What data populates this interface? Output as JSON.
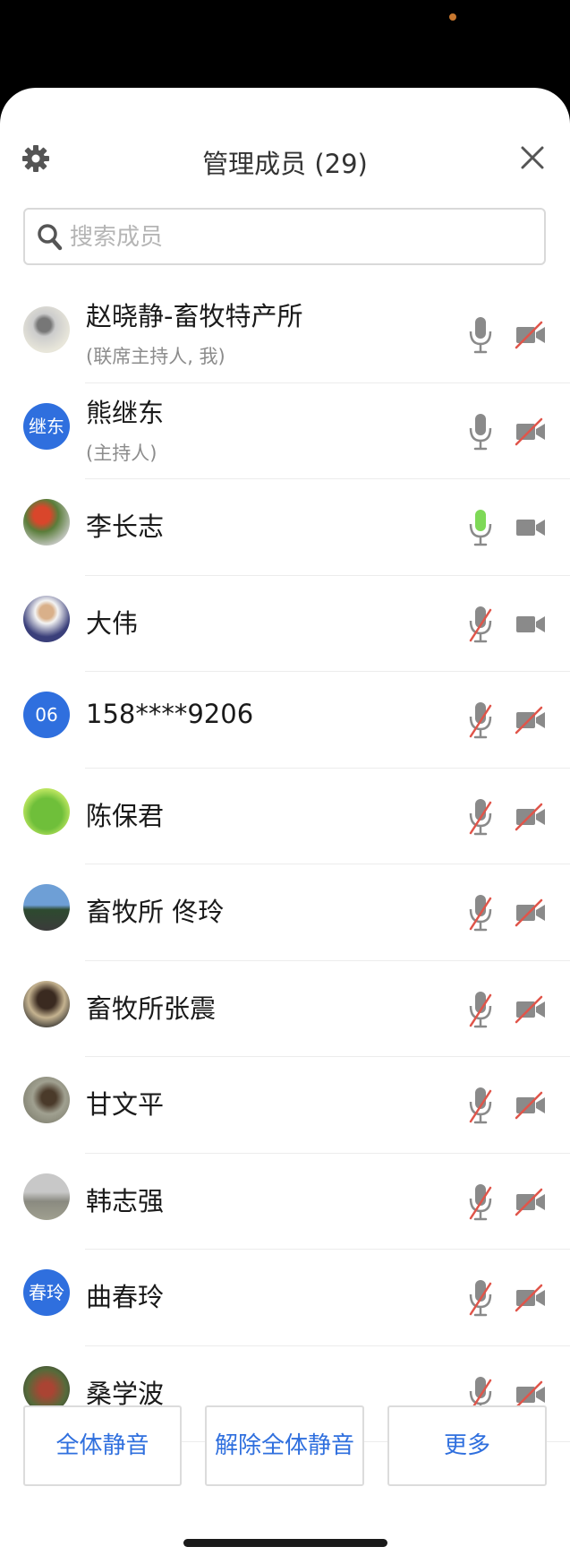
{
  "header": {
    "title": "管理成员 (29)"
  },
  "search": {
    "placeholder": "搜索成员"
  },
  "members": [
    {
      "name": "赵晓静-畜牧特产所",
      "role": "(联席主持人, 我)",
      "avatar_text": "",
      "mic": "off",
      "cam": "off"
    },
    {
      "name": "熊继东",
      "role": "(主持人)",
      "avatar_text": "继东",
      "mic": "off",
      "cam": "off"
    },
    {
      "name": "李长志",
      "role": "",
      "avatar_text": "",
      "mic": "speaking",
      "cam": "on"
    },
    {
      "name": "大伟",
      "role": "",
      "avatar_text": "",
      "mic": "muted",
      "cam": "on"
    },
    {
      "name": "158****9206",
      "role": "",
      "avatar_text": "06",
      "mic": "muted",
      "cam": "off"
    },
    {
      "name": "陈保君",
      "role": "",
      "avatar_text": "",
      "mic": "muted",
      "cam": "off"
    },
    {
      "name": "畜牧所 佟玲",
      "role": "",
      "avatar_text": "",
      "mic": "muted",
      "cam": "off"
    },
    {
      "name": "畜牧所张震",
      "role": "",
      "avatar_text": "",
      "mic": "muted",
      "cam": "off"
    },
    {
      "name": "甘文平",
      "role": "",
      "avatar_text": "",
      "mic": "muted",
      "cam": "off"
    },
    {
      "name": "韩志强",
      "role": "",
      "avatar_text": "",
      "mic": "muted",
      "cam": "off"
    },
    {
      "name": "曲春玲",
      "role": "",
      "avatar_text": "春玲",
      "mic": "muted",
      "cam": "off"
    },
    {
      "name": "桑学波",
      "role": "",
      "avatar_text": "",
      "mic": "muted",
      "cam": "off"
    }
  ],
  "actions": {
    "mute_all": "全体静音",
    "unmute_all": "解除全体静音",
    "more": "更多"
  },
  "colors": {
    "accent": "#2f6fde",
    "speaking": "#7ed957",
    "muted_slash": "#e0554a",
    "icon_gray": "#8a8a8a"
  }
}
